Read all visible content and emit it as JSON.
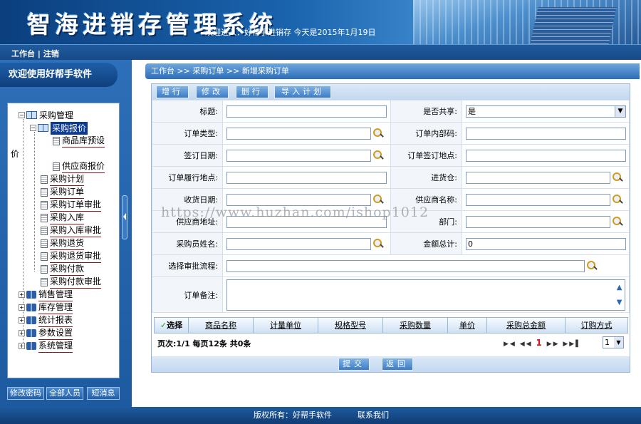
{
  "header": {
    "title": "智海进销存管理系统",
    "welcome": "欢迎进入：好帮手进销存 今天是2015年1月19日"
  },
  "toolbar": {
    "workbench": "工作台",
    "separator": "|",
    "logout": "注销"
  },
  "sidebar": {
    "title": "欢迎使用好帮手软件",
    "tree": {
      "purchase_mgmt": "采购管理",
      "purchase_quote": "采购报价",
      "catalog_preset_a": "商品库预设",
      "catalog_preset_b": "价",
      "supplier_quote": "供应商报价",
      "items": [
        "采购计划",
        "采购订单",
        "采购订单审批",
        "采购入库",
        "采购入库审批",
        "采购退货",
        "采购退货审批",
        "采购付款",
        "采购付款审批"
      ],
      "groups": [
        "销售管理",
        "库存管理",
        "统计报表",
        "参数设置",
        "系统管理"
      ]
    },
    "buttons": {
      "change_password": "修改密码",
      "all_staff": "全部人员",
      "sms": "短消息"
    }
  },
  "breadcrumb": "工作台 >> 采购订单 >> 新增采购订单",
  "actions": {
    "add": "增行",
    "edit": "修改",
    "delete": "删行",
    "import": "导入计划"
  },
  "form": {
    "title_label": "标题:",
    "shared_label": "是否共享:",
    "shared_value": "是",
    "order_type_label": "订单类型:",
    "internal_code_label": "订单内部码:",
    "sign_date_label": "签订日期:",
    "sign_place_label": "订单签订地点:",
    "fulfill_place_label": "订单履行地点:",
    "warehouse_label": "进货仓:",
    "receive_date_label": "收货日期:",
    "supplier_name_label": "供应商名称:",
    "supplier_addr_label": "供应商地址:",
    "dept_label": "部门:",
    "buyer_label": "采购员姓名:",
    "total_label": "金额总计:",
    "total_value": "0",
    "flow_label": "选择审批流程:",
    "remark_label": "订单备注:"
  },
  "grid": {
    "columns": [
      "选择",
      "商品名称",
      "计量单位",
      "规格型号",
      "采购数量",
      "单价",
      "采购总金额",
      "订购方式"
    ],
    "pager": "页次:1/1 每页12条 共0条",
    "current_page": "1",
    "page_select": "1"
  },
  "submit": {
    "submit": "提交",
    "back": "返回"
  },
  "watermark": "https://www.huzhan.com/ishop1012",
  "footer": {
    "copyright": "版权所有：好帮手软件",
    "contact": "联系我们"
  }
}
